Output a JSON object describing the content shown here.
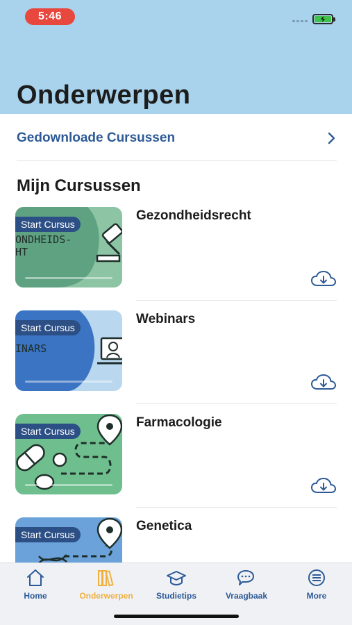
{
  "status_bar": {
    "time": "5:46"
  },
  "header": {
    "title": "Onderwerpen"
  },
  "downloads": {
    "label": "Gedownloade Cursussen"
  },
  "section": {
    "title": "Mijn Cursussen"
  },
  "courses": [
    {
      "title": "Gezondheidsrecht",
      "badge": "Start Cursus",
      "thumb_text": "ONDHEIDS-\nHT",
      "theme_color": "#8cc4a4",
      "progress": 0.0,
      "icon": "gavel-icon"
    },
    {
      "title": "Webinars",
      "badge": "Start Cursus",
      "thumb_text": "INARS",
      "theme_color": "#3a74c2",
      "progress": 0.0,
      "icon": "laptop-icon"
    },
    {
      "title": "Farmacologie",
      "badge": "Start Cursus",
      "thumb_text": "",
      "theme_color": "#6fbf8e",
      "progress": 0.0,
      "icon": "pills-icon"
    },
    {
      "title": "Genetica",
      "badge": "Start Cursus",
      "thumb_text": "",
      "theme_color": "#6aa2d9",
      "progress": 0.0,
      "icon": "dna-icon"
    }
  ],
  "tabs": [
    {
      "label": "Home",
      "icon": "home-icon",
      "active": false
    },
    {
      "label": "Onderwerpen",
      "icon": "books-icon",
      "active": true
    },
    {
      "label": "Studietips",
      "icon": "graduation-cap-icon",
      "active": false
    },
    {
      "label": "Vraagbaak",
      "icon": "chat-bubbles-icon",
      "active": false
    },
    {
      "label": "More",
      "icon": "more-list-icon",
      "active": false
    }
  ],
  "colors": {
    "header": "#a9d3ec",
    "accent": "#2d5a96",
    "active_tab": "#f0b040",
    "badge": "#2c4f85"
  }
}
